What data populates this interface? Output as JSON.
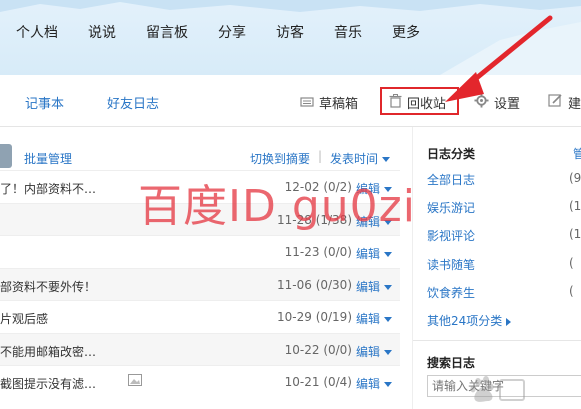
{
  "topnav": {
    "items": [
      "个人档",
      "说说",
      "留言板",
      "分享",
      "访客",
      "音乐",
      "更多"
    ]
  },
  "tabbar": {
    "tabs": [
      "记事本",
      "好友日志"
    ],
    "tools": {
      "drafts": "草稿箱",
      "recycle": "回收站",
      "settings": "设置",
      "create": "建"
    }
  },
  "listbar": {
    "batch": "批量管理",
    "switch_view": "切换到摘要",
    "separator": "|",
    "sort": "发表时间"
  },
  "entries": [
    {
      "title": "了！内部资料不…",
      "date": "12-02",
      "count": "(0/2)",
      "edit": "编辑"
    },
    {
      "title": "",
      "date": "11-28",
      "count": "(1/38)",
      "edit": "编辑"
    },
    {
      "title": "",
      "date": "11-23",
      "count": "(0/0)",
      "edit": "编辑"
    },
    {
      "title": "部资料不要外传！",
      "date": "11-06",
      "count": "(0/30)",
      "edit": "编辑"
    },
    {
      "title": "片观后感",
      "date": "10-29",
      "count": "(0/19)",
      "edit": "编辑"
    },
    {
      "title": "不能用邮箱改密…",
      "date": "10-22",
      "count": "(0/0)",
      "edit": "编辑"
    },
    {
      "title": "截图提示没有滤…",
      "date": "10-21",
      "count": "(0/4)",
      "edit": "编辑"
    }
  ],
  "sidebar": {
    "categories_title": "日志分类",
    "manage": "管",
    "categories": [
      {
        "name": "全部日志",
        "count": "(9"
      },
      {
        "name": "娱乐游记",
        "count": "(1"
      },
      {
        "name": "影视评论",
        "count": "(1"
      },
      {
        "name": "读书随笔",
        "count": "("
      },
      {
        "name": "饮食养生",
        "count": "("
      }
    ],
    "more": "其他24项分类",
    "search_title": "搜索日志",
    "search_placeholder": "请输入关键字"
  },
  "watermark": "百度ID gu0zi",
  "colors": {
    "accent": "#2a76c6",
    "highlight": "#e0272b",
    "nav_bg": "#dcedf9"
  }
}
